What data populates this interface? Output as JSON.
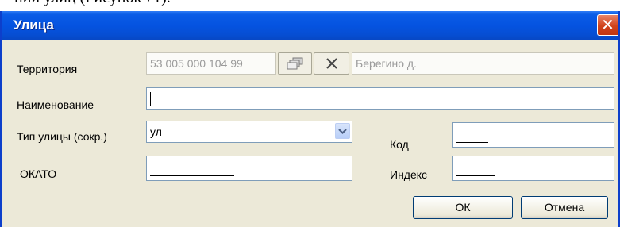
{
  "doc": {
    "caption": "ний улиц (Рисунок 71)."
  },
  "dialog": {
    "title": "Улица",
    "close_label": "✕"
  },
  "form": {
    "territory": {
      "label": "Территория",
      "code": "53 005 000 104 99",
      "name": "Берегино д."
    },
    "name": {
      "label": "Наименование",
      "value": ""
    },
    "street_type": {
      "label": "Тип улицы (сокр.)",
      "value": "ул"
    },
    "code": {
      "label": "Код"
    },
    "okato": {
      "label": "ОКАТО"
    },
    "index": {
      "label": "Индекс"
    }
  },
  "buttons": {
    "ok": "ОК",
    "cancel": "Отмена"
  },
  "colors": {
    "title_bar": "#0553e0",
    "window_bg": "#ece9d8",
    "close": "#d0431c"
  },
  "icons": [
    "select-icon",
    "clear-icon",
    "chevron-down-icon",
    "close-icon"
  ]
}
